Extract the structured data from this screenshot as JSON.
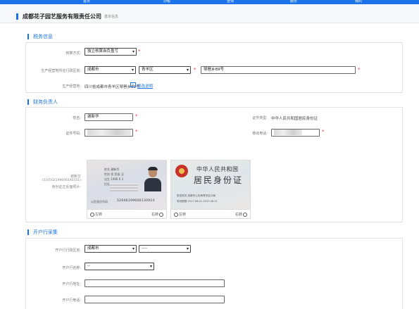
{
  "topnav": {
    "items": [
      "首页",
      "办税",
      "查询",
      "服务",
      "我的"
    ]
  },
  "header": {
    "company": "成都花子园艺服务有限责任公司",
    "subnav": "基本信息"
  },
  "tax_section": {
    "title": "税务信息",
    "accounting_label": "核算方式:",
    "accounting_value": "独立核算自负盈亏",
    "address_label": "生产经营地所在行政区划:",
    "city_value": "成都市",
    "district_value": "青羊区",
    "street_value": "琴琶乡89号",
    "registered_label": "生产经营地:",
    "registered_value": "四川省成都市青羊区琴琶乡89号",
    "modify_link": "修改说明"
  },
  "finance_section": {
    "title": "财务负责人",
    "name_label": "姓名:",
    "name_value": "谢新华",
    "id_type_label": "证件类型:",
    "id_type_value": "中华人民共和国居民身份证",
    "id_number_label": "证件号码:",
    "phone_label": "移动电话:",
    "photo_label_1": "谢新华",
    "photo_label_2": "(5105021996061X0351)",
    "photo_label_3": "身份证正反面照片:",
    "card_front": {
      "name_row": "姓名 谢新华",
      "gender_row": "性别 男  民族 汉",
      "birth_row": "出生 1996 6 3",
      "addr_row": "住址",
      "id_label": "公民身份号码",
      "id_tail": "5204619960613091X"
    },
    "card_back": {
      "title1": "中华人民共和国",
      "title2": "居民身份证",
      "authority": "签发机关 成都市公安局青羊区分局",
      "validity": "有效期限 2017.06.21-2037.06.21"
    },
    "rotate_left": "左转",
    "rotate_right": "右转"
  },
  "bank_section": {
    "title": "开户行采集",
    "region_label": "开户行行政区划:",
    "city_value": "成都市",
    "district_value": "----",
    "bank_name_label": "开户行名称:",
    "bank_name_value": "--",
    "bank_address_label": "开户行地址:",
    "bank_phone_label": "开户行电话:"
  },
  "colors": {
    "accent": "#1a73e8",
    "required": "#e53935"
  }
}
